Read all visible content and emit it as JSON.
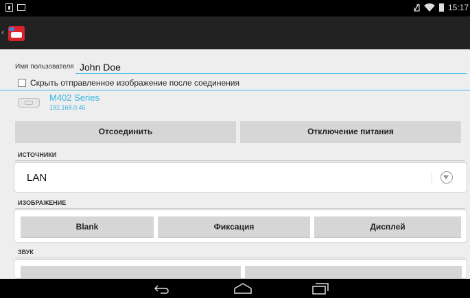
{
  "status_bar": {
    "time": "15:17",
    "icons": [
      "notification-box-icon",
      "screenshot-icon",
      "no-sim-icon",
      "wifi-icon",
      "battery-icon"
    ]
  },
  "action_bar": {
    "back_icon": "chevron-left-icon",
    "logo_icon": "projector-app-logo"
  },
  "user": {
    "label": "Имя пользователя",
    "value": "John Doe"
  },
  "hide_image_checkbox": {
    "label": "Скрыть отправленное изображение после соединения",
    "checked": false
  },
  "device": {
    "name": "M402 Series",
    "ip": "192.168.0.45",
    "icon": "projector-icon"
  },
  "actions": {
    "disconnect": "Отсоединить",
    "power_off": "Отключение питания"
  },
  "sources": {
    "title": "ИСТОЧНИКИ",
    "selected": "LAN"
  },
  "image": {
    "title": "ИЗОБРАЖЕНИЕ",
    "buttons": [
      "Blank",
      "Фиксация",
      "Дисплей"
    ]
  },
  "sound": {
    "title": "ЗВУК"
  },
  "nav_bar": {
    "icons": [
      "back-icon",
      "home-icon",
      "recents-icon"
    ]
  },
  "colors": {
    "accent": "#33b5e5",
    "button_bg": "#d6d6d6",
    "logo_red": "#d8232a"
  }
}
